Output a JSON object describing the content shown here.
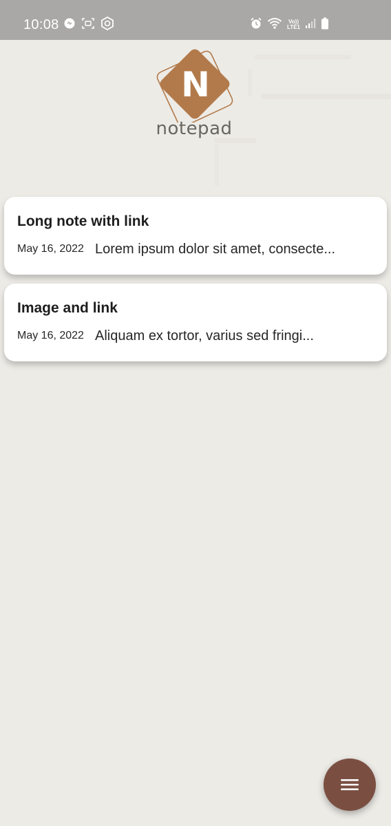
{
  "status_bar": {
    "time": "10:08",
    "left_icons": [
      "notification-dot-icon",
      "screenshot-icon",
      "vpn-shield-icon"
    ],
    "right_icons": [
      "alarm-icon",
      "wifi-icon",
      "volte-lte-icon",
      "signal-icon",
      "battery-icon"
    ],
    "volte_label": "Vo))",
    "lte_label": "LTE1"
  },
  "logo": {
    "letter": "N",
    "wordmark": "notepad",
    "color": "#b27a4b"
  },
  "notes": [
    {
      "title": "Long note with link",
      "date": "May 16, 2022",
      "preview": "Lorem ipsum dolor sit amet, consecte..."
    },
    {
      "title": "Image and link",
      "date": "May 16, 2022",
      "preview": "Aliquam ex tortor, varius sed fringi..."
    }
  ],
  "fab": {
    "icon": "menu-icon",
    "color": "#7a4f42"
  },
  "colors": {
    "background": "#edebe6",
    "status_bar": "#a9a8a6",
    "card": "#ffffff"
  }
}
